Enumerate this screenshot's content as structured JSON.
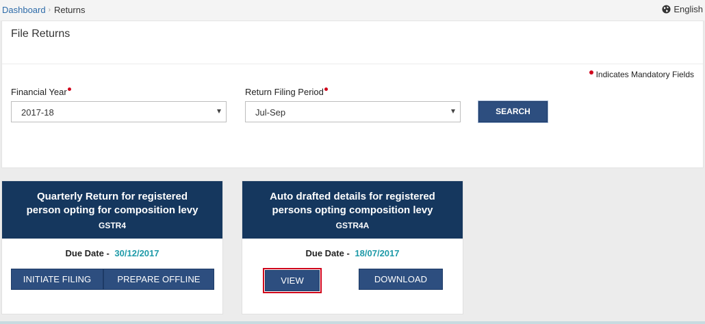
{
  "breadcrumb": {
    "home": "Dashboard",
    "separator": "›",
    "current": "Returns"
  },
  "language": {
    "label": "English",
    "icon": "globe-icon"
  },
  "panel": {
    "title": "File Returns",
    "mandatory_note": "Indicates Mandatory Fields",
    "financial_year": {
      "label": "Financial Year",
      "value": "2017-18"
    },
    "return_period": {
      "label": "Return Filing Period",
      "value": "Jul-Sep"
    },
    "search_label": "SEARCH"
  },
  "cards": [
    {
      "title_line1": "Quarterly Return for registered",
      "title_line2": "person opting for composition levy",
      "code": "GSTR4",
      "due_label": "Due Date -",
      "due_date": "30/12/2017",
      "buttons": [
        "INITIATE FILING",
        "PREPARE OFFLINE"
      ]
    },
    {
      "title_line1": "Auto drafted details for registered",
      "title_line2": "persons opting composition levy",
      "code": "GSTR4A",
      "due_label": "Due Date -",
      "due_date": "18/07/2017",
      "buttons": [
        "VIEW",
        "DOWNLOAD"
      ]
    }
  ],
  "colors": {
    "header_navy": "#15375e",
    "button_blue": "#2d4e7f",
    "due_teal": "#1e9aa8",
    "required_red": "#d0021b",
    "link_blue": "#2c6aa8"
  }
}
